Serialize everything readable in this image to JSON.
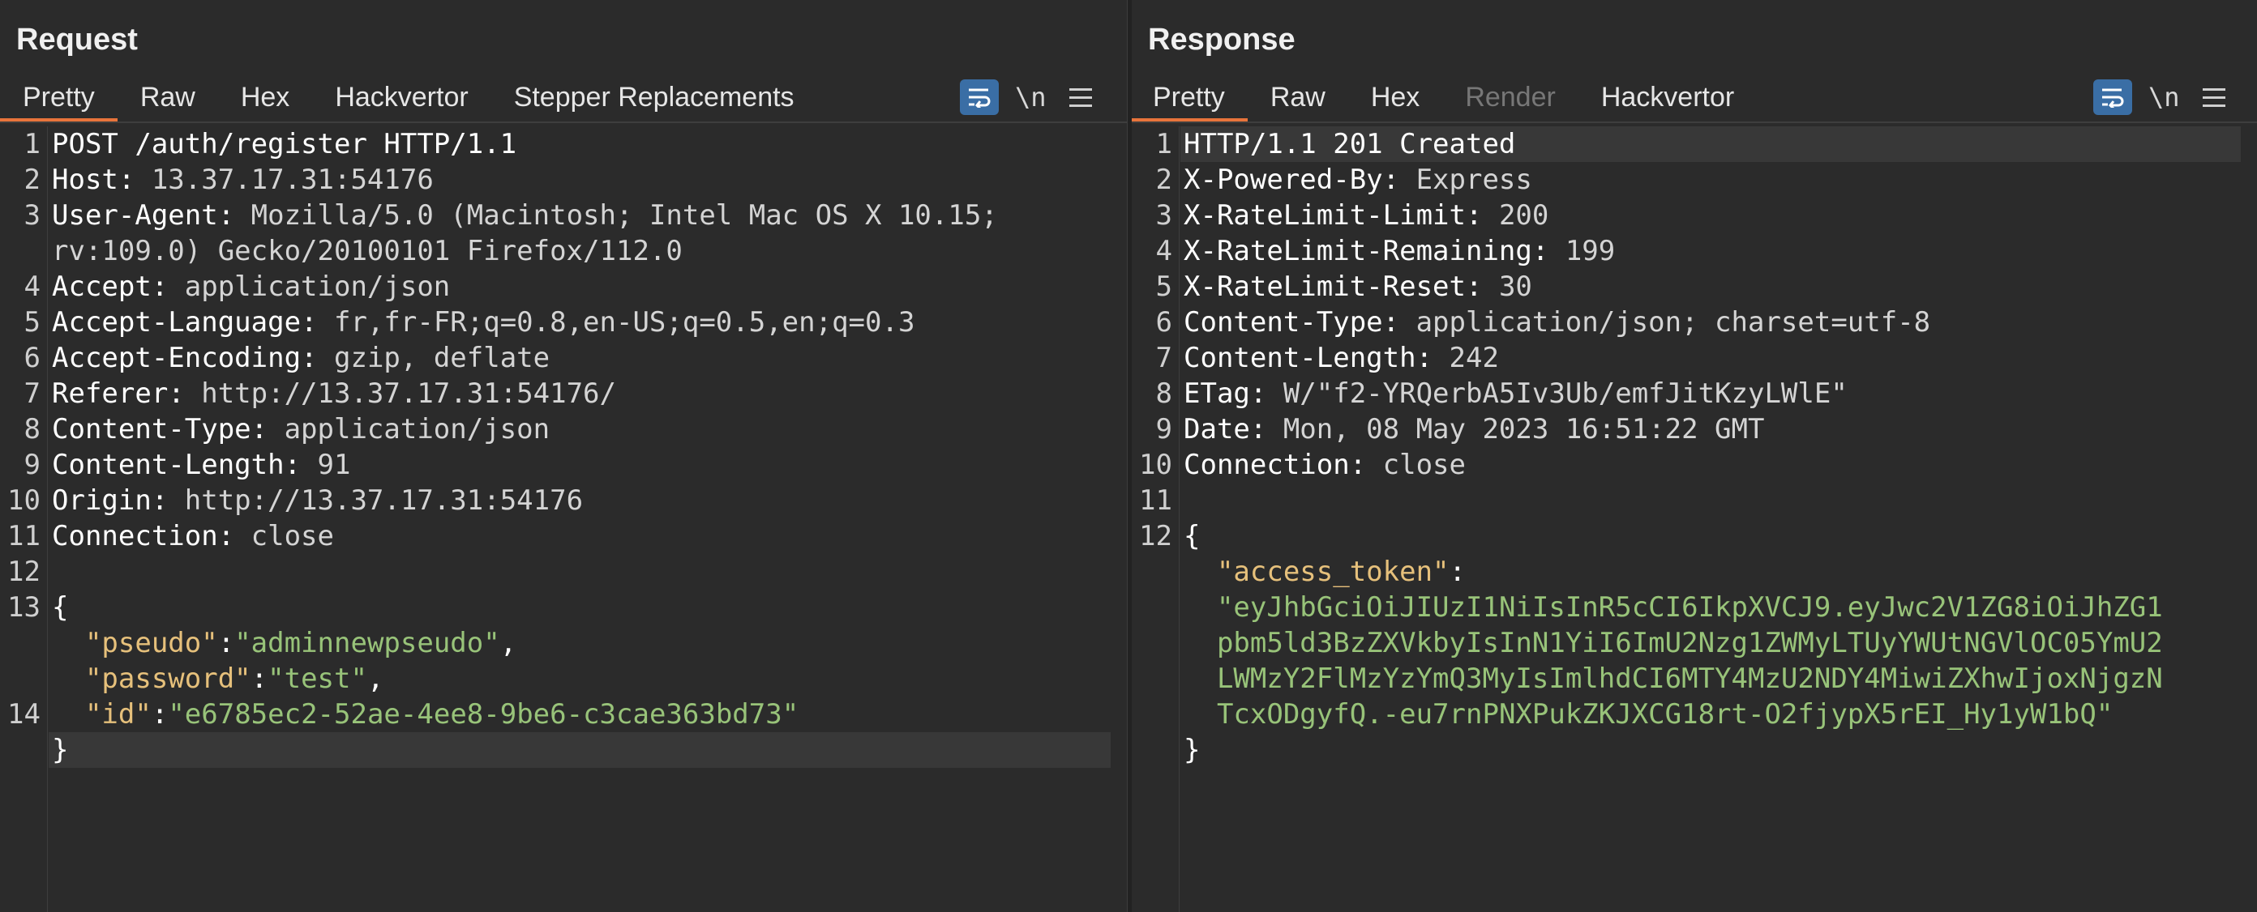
{
  "request": {
    "title": "Request",
    "tabs": [
      {
        "label": "Pretty",
        "active": true
      },
      {
        "label": "Raw"
      },
      {
        "label": "Hex"
      },
      {
        "label": "Hackvertor"
      },
      {
        "label": "Stepper Replacements"
      }
    ],
    "icons": {
      "wrap": "wrap-lines-icon",
      "newline": "\\n",
      "menu": "hamburger-menu-icon"
    },
    "line_numbers": [
      "1",
      "2",
      "3",
      "4",
      "5",
      "6",
      "7",
      "8",
      "9",
      "10",
      "11",
      "12",
      "13",
      "14"
    ],
    "headers": [
      {
        "k": "POST /auth/register HTTP/1.1",
        "v": ""
      },
      {
        "k": "Host: ",
        "v": "13.37.17.31:54176"
      },
      {
        "k": "User-Agent: ",
        "v": "Mozilla/5.0 (Macintosh; Intel Mac OS X 10.15;"
      },
      {
        "k": "",
        "v": "rv:109.0) Gecko/20100101 Firefox/112.0"
      },
      {
        "k": "Accept: ",
        "v": "application/json"
      },
      {
        "k": "Accept-Language: ",
        "v": "fr,fr-FR;q=0.8,en-US;q=0.5,en;q=0.3"
      },
      {
        "k": "Accept-Encoding: ",
        "v": "gzip, deflate"
      },
      {
        "k": "Referer: ",
        "v": "http://13.37.17.31:54176/"
      },
      {
        "k": "Content-Type: ",
        "v": "application/json"
      },
      {
        "k": "Content-Length: ",
        "v": "91"
      },
      {
        "k": "Origin: ",
        "v": "http://13.37.17.31:54176"
      },
      {
        "k": "Connection: ",
        "v": "close"
      }
    ],
    "body": {
      "open": "{",
      "fields": [
        {
          "key": "\"pseudo\"",
          "sep": ":",
          "val": "\"adminnewpseudo\"",
          "tail": ","
        },
        {
          "key": "\"password\"",
          "sep": ":",
          "val": "\"test\"",
          "tail": ","
        },
        {
          "key": "\"id\"",
          "sep": ":",
          "val": "\"e6785ec2-52ae-4ee8-9be6-c3cae363bd73\"",
          "tail": ""
        }
      ],
      "close": "}"
    }
  },
  "response": {
    "title": "Response",
    "tabs": [
      {
        "label": "Pretty",
        "active": true
      },
      {
        "label": "Raw"
      },
      {
        "label": "Hex"
      },
      {
        "label": "Render",
        "disabled": true
      },
      {
        "label": "Hackvertor"
      }
    ],
    "line_numbers": [
      "1",
      "2",
      "3",
      "4",
      "5",
      "6",
      "7",
      "8",
      "9",
      "10",
      "11",
      "12"
    ],
    "headers": [
      {
        "k": "HTTP/1.1 201 Created",
        "v": ""
      },
      {
        "k": "X-Powered-By: ",
        "v": "Express"
      },
      {
        "k": "X-RateLimit-Limit: ",
        "v": "200"
      },
      {
        "k": "X-RateLimit-Remaining: ",
        "v": "199"
      },
      {
        "k": "X-RateLimit-Reset: ",
        "v": "30"
      },
      {
        "k": "Content-Type: ",
        "v": "application/json; charset=utf-8"
      },
      {
        "k": "Content-Length: ",
        "v": "242"
      },
      {
        "k": "ETag: ",
        "v": "W/\"f2-YRQerbA5Iv3Ub/emfJitKzyLWlE\""
      },
      {
        "k": "Date: ",
        "v": "Mon, 08 May 2023 16:51:22 GMT"
      },
      {
        "k": "Connection: ",
        "v": "close"
      }
    ],
    "body": {
      "open": "{",
      "key": "\"access_token\"",
      "sep": ":",
      "token_lines": [
        "\"eyJhbGciOiJIUzI1NiIsInR5cCI6IkpXVCJ9.eyJwc2V1ZG8iOiJhZG1",
        "pbm5ld3BzZXVkbyIsInN1YiI6ImU2Nzg1ZWMyLTUyYWUtNGVlOC05YmU2",
        "LWMzY2FlMzYzYmQ3MyIsImlhdCI6MTY4MzU2NDY4MiwiZXhwIjoxNjgzN",
        "TcxODgyfQ.-eu7rnPNXPukZKJXCG18rt-O2fjypX5rEI_Hy1yW1bQ\""
      ],
      "close": "}"
    }
  },
  "layout_buttons": [
    "split-horizontal-icon",
    "split-vertical-icon",
    "single-pane-icon"
  ],
  "colors": {
    "accent": "#e8743b",
    "button_active": "#3a6ea5",
    "json_key": "#e6c07b",
    "json_string": "#98c379"
  }
}
